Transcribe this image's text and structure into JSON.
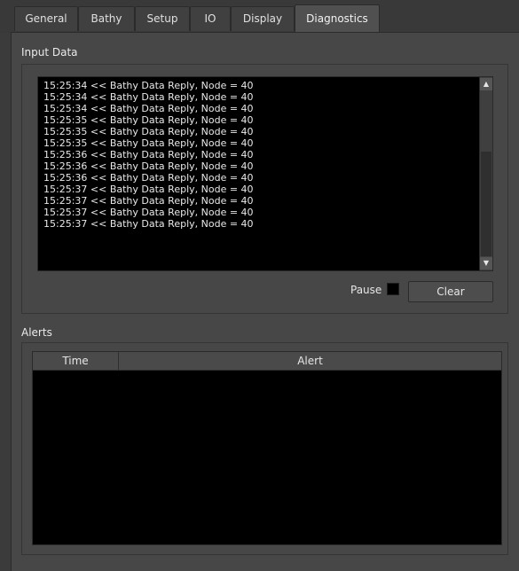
{
  "tabs": [
    "General",
    "Bathy",
    "Setup",
    "IO",
    "Display",
    "Diagnostics"
  ],
  "active_tab": "Diagnostics",
  "input_data": {
    "title": "Input Data",
    "lines": [
      "15:25:34 << Bathy Data Reply, Node = 40",
      "15:25:34 << Bathy Data Reply, Node = 40",
      "15:25:34 << Bathy Data Reply, Node = 40",
      "15:25:35 << Bathy Data Reply, Node = 40",
      "15:25:35 << Bathy Data Reply, Node = 40",
      "15:25:35 << Bathy Data Reply, Node = 40",
      "15:25:36 << Bathy Data Reply, Node = 40",
      "15:25:36 << Bathy Data Reply, Node = 40",
      "15:25:36 << Bathy Data Reply, Node = 40",
      "15:25:37 << Bathy Data Reply, Node = 40",
      "15:25:37 << Bathy Data Reply, Node = 40",
      "15:25:37 << Bathy Data Reply, Node = 40",
      "15:25:37 << Bathy Data Reply, Node = 40"
    ],
    "pause_label": "Pause",
    "pause_checked": false,
    "clear_label": "Clear"
  },
  "alerts": {
    "title": "Alerts",
    "columns": [
      "Time",
      "Alert"
    ],
    "rows": []
  },
  "icons": {
    "scroll_up": "arrow-up-icon",
    "scroll_down": "arrow-down-icon"
  }
}
